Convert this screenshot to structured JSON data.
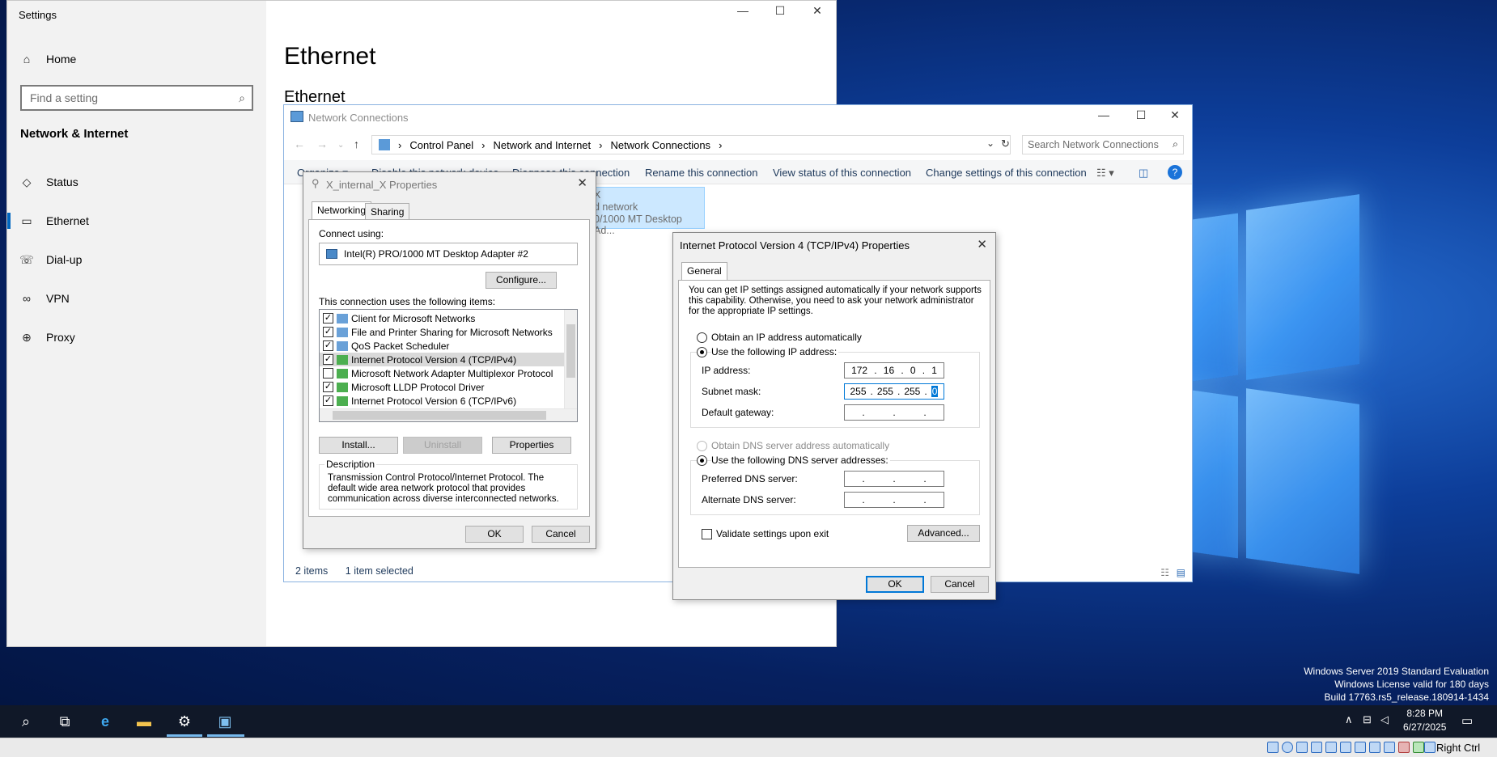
{
  "desktop": {
    "watermark": [
      "Windows Server 2019 Standard Evaluation",
      "Windows License valid for 180 days",
      "Build 17763.rs5_release.180914-1434"
    ]
  },
  "settings": {
    "window_title": "Settings",
    "home": "Home",
    "search_placeholder": "Find a setting",
    "section": "Network & Internet",
    "nav": [
      {
        "label": "Status",
        "icon": "status-icon"
      },
      {
        "label": "Ethernet",
        "icon": "ethernet-icon"
      },
      {
        "label": "Dial-up",
        "icon": "dialup-icon"
      },
      {
        "label": "VPN",
        "icon": "vpn-icon"
      },
      {
        "label": "Proxy",
        "icon": "globe-icon"
      }
    ],
    "page_title": "Ethernet",
    "page_subtitle": "Ethernet"
  },
  "netconn": {
    "title": "Network Connections",
    "breadcrumb": [
      "Control Panel",
      "Network and Internet",
      "Network Connections"
    ],
    "search_placeholder": "Search Network Connections",
    "commands": [
      "Organize ▾",
      "Disable this network device",
      "Diagnose this connection",
      "Rename this connection",
      "View status of this connection",
      "Change settings of this connection"
    ],
    "item_lines": [
      "X",
      "d network",
      "0/1000 MT Desktop Ad..."
    ],
    "status_items": "2 items",
    "status_selected": "1 item selected"
  },
  "props": {
    "title": "X_internal_X Properties",
    "tabs": [
      "Networking",
      "Sharing"
    ],
    "connect_using_label": "Connect using:",
    "adapter": "Intel(R) PRO/1000 MT Desktop Adapter #2",
    "configure": "Configure...",
    "items_label": "This connection uses the following items:",
    "items": [
      {
        "label": "Client for Microsoft Networks",
        "checked": true
      },
      {
        "label": "File and Printer Sharing for Microsoft Networks",
        "checked": true
      },
      {
        "label": "QoS Packet Scheduler",
        "checked": true
      },
      {
        "label": "Internet Protocol Version 4 (TCP/IPv4)",
        "checked": true
      },
      {
        "label": "Microsoft Network Adapter Multiplexor Protocol",
        "checked": false
      },
      {
        "label": "Microsoft LLDP Protocol Driver",
        "checked": true
      },
      {
        "label": "Internet Protocol Version 6 (TCP/IPv6)",
        "checked": true
      }
    ],
    "install": "Install...",
    "uninstall": "Uninstall",
    "properties": "Properties",
    "description_label": "Description",
    "description": "Transmission Control Protocol/Internet Protocol. The default wide area network protocol that provides communication across diverse interconnected networks.",
    "ok": "OK",
    "cancel": "Cancel"
  },
  "ipv4": {
    "title": "Internet Protocol Version 4 (TCP/IPv4) Properties",
    "tab": "General",
    "intro": "You can get IP settings assigned automatically if your network supports this capability. Otherwise, you need to ask your network administrator for the appropriate IP settings.",
    "auto_ip": "Obtain an IP address automatically",
    "use_ip": "Use the following IP address:",
    "ip_label": "IP address:",
    "ip_value": [
      "172",
      "16",
      "0",
      "1"
    ],
    "mask_label": "Subnet mask:",
    "mask_value": [
      "255",
      "255",
      "255",
      "0"
    ],
    "gateway_label": "Default gateway:",
    "auto_dns": "Obtain DNS server address automatically",
    "use_dns": "Use the following DNS server addresses:",
    "pref_dns_label": "Preferred DNS server:",
    "alt_dns_label": "Alternate DNS server:",
    "validate": "Validate settings upon exit",
    "advanced": "Advanced...",
    "ok": "OK",
    "cancel": "Cancel"
  },
  "taskbar": {
    "time": "8:28 PM",
    "date": "6/27/2025"
  },
  "vbox": {
    "host_key": "Right Ctrl"
  }
}
